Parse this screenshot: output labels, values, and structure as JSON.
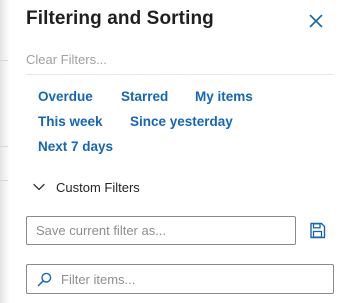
{
  "panel": {
    "title": "Filtering and Sorting",
    "close_icon": "close-icon",
    "clear_filters": "Clear Filters..."
  },
  "quick_filters": [
    {
      "label": "Overdue"
    },
    {
      "label": "Starred"
    },
    {
      "label": "My items"
    },
    {
      "label": "This week"
    },
    {
      "label": "Since yesterday"
    },
    {
      "label": "Next 7 days"
    }
  ],
  "custom_filters": {
    "label": "Custom Filters",
    "expand_icon": "chevron-down-icon",
    "expanded": true
  },
  "save_filter": {
    "value": "",
    "placeholder": "Save current filter as...",
    "save_icon": "save-icon"
  },
  "filter_search": {
    "value": "",
    "placeholder": "Filter items...",
    "search_icon": "search-icon"
  },
  "colors": {
    "link": "#1566b8",
    "title": "#1f1f1f",
    "placeholder": "#8e8e8e",
    "border": "#8a8a8a"
  }
}
